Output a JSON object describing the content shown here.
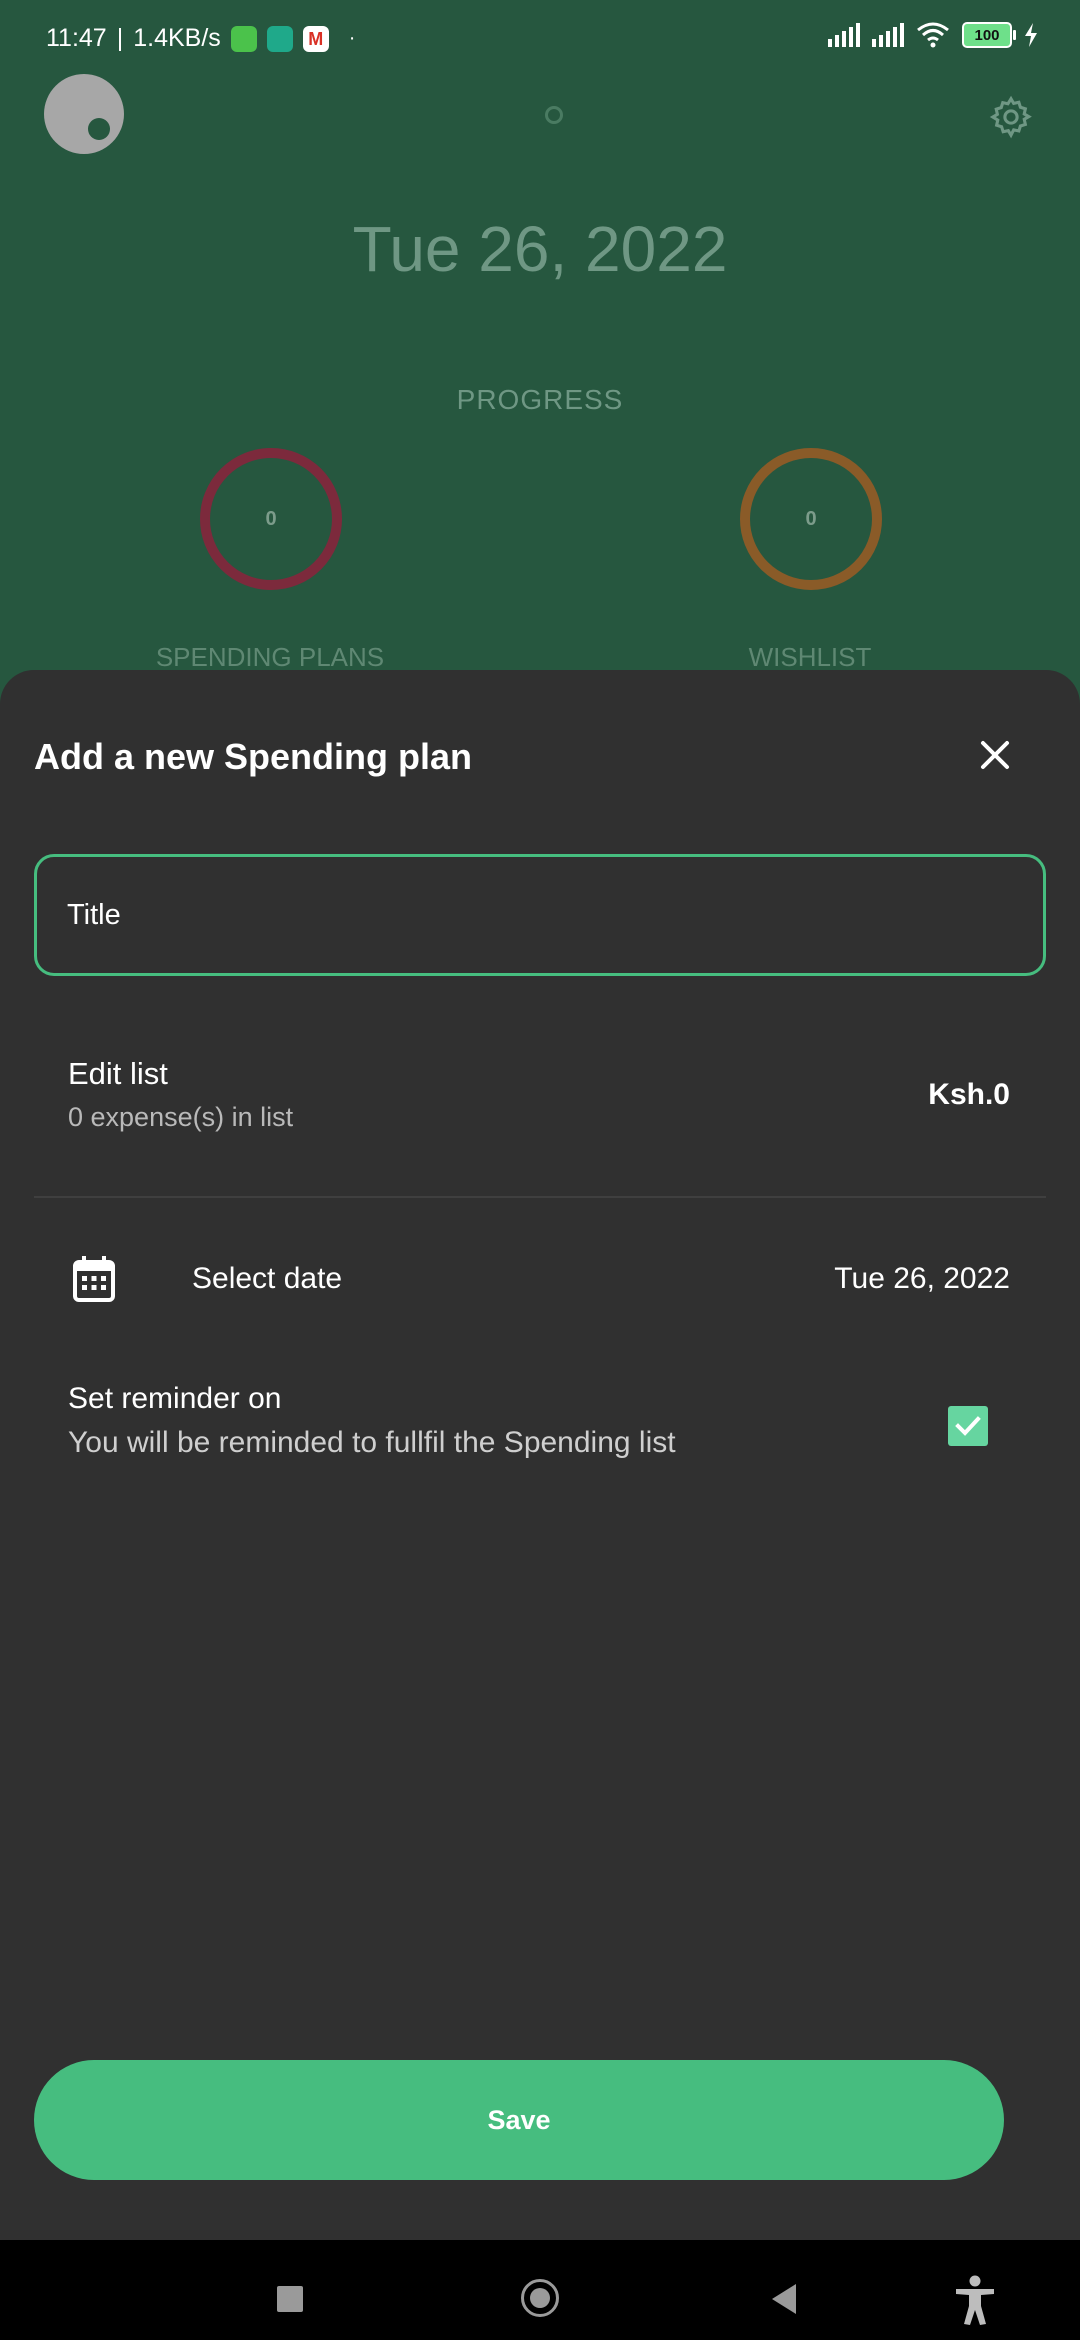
{
  "status_bar": {
    "time": "11:47",
    "network_speed": "1.4KB/s",
    "battery": "100",
    "notification_icons": [
      "message-icon",
      "shield-icon",
      "gmail-icon"
    ]
  },
  "background_app": {
    "date": "Tue 26, 2022",
    "progress_label": "PROGRESS",
    "spending_plans": {
      "label": "SPENDING PLANS",
      "count": "0"
    },
    "wishlist": {
      "label": "WISHLIST",
      "count": "0"
    }
  },
  "sheet": {
    "title": "Add a new Spending plan",
    "title_field": {
      "placeholder": "Title",
      "value": ""
    },
    "edit_list": {
      "label": "Edit list",
      "subtitle": "0 expense(s) in list",
      "amount": "Ksh.0"
    },
    "date": {
      "label": "Select date",
      "value": "Tue 26, 2022"
    },
    "reminder": {
      "label": "Set reminder on",
      "subtitle": "You will be reminded to fullfil the Spending list",
      "checked": true
    },
    "save_label": "Save"
  },
  "colors": {
    "accent": "#46bd7f",
    "sheet_bg": "#303030",
    "app_bg": "#26573f"
  }
}
